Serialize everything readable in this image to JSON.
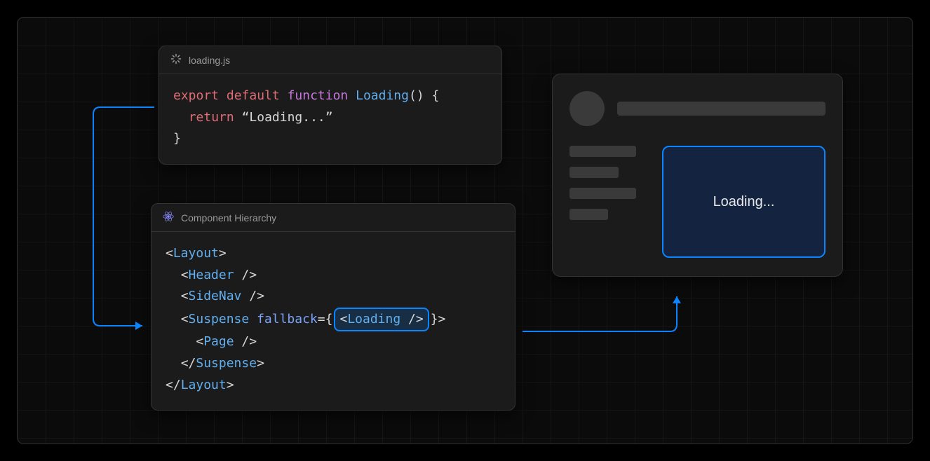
{
  "loading_panel": {
    "title": "loading.js",
    "code": {
      "kw_export": "export",
      "kw_default": "default",
      "kw_function": "function",
      "fn_name": "Loading",
      "parens": "()",
      "brace_open": " {",
      "kw_return": "return",
      "string_literal": "“Loading...”",
      "brace_close": "}"
    }
  },
  "hierarchy_panel": {
    "title": "Component Hierarchy",
    "tags": {
      "layout": "Layout",
      "header": "Header",
      "sidenav": "SideNav",
      "suspense": "Suspense",
      "fallback_attr": "fallback",
      "loading": "Loading",
      "page": "Page"
    }
  },
  "browser_mock": {
    "loading_text": "Loading..."
  },
  "colors": {
    "accent": "#0a84ff",
    "panel_bg": "#1b1b1b",
    "panel_border": "#333333",
    "skeleton": "#3a3a3a",
    "highlight_fill": "#14233f"
  }
}
